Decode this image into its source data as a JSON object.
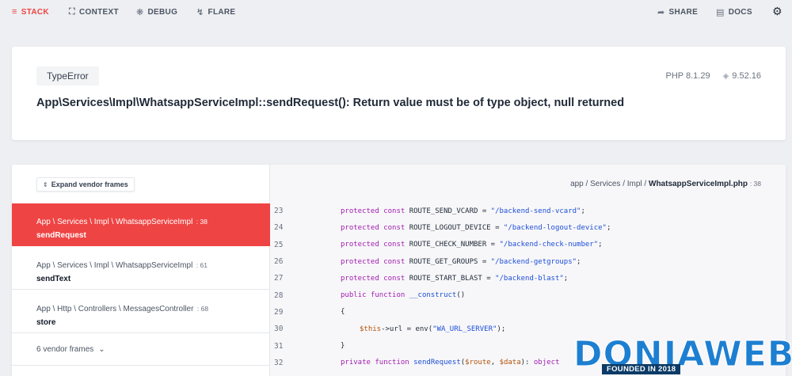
{
  "nav": {
    "stack": "STACK",
    "context": "CONTEXT",
    "debug": "DEBUG",
    "flare": "FLARE",
    "share": "SHARE",
    "docs": "DOCS",
    "icons": [
      "list-icon",
      "context-icon",
      "bug-icon",
      "flare-icon",
      "share-icon",
      "book-icon",
      "gear-icon"
    ]
  },
  "error": {
    "class": "TypeError",
    "php_version": "PHP 8.1.29",
    "laravel_version": "9.52.16",
    "message": "App\\Services\\Impl\\WhatsappServiceImpl::sendRequest(): Return value must be of type object, null returned"
  },
  "stack": {
    "expand_label": "Expand vendor frames",
    "frames": [
      {
        "path": "App \\ Services \\ Impl \\ WhatsappServiceImpl",
        "line": ": 38",
        "method": "sendRequest"
      },
      {
        "path": "App \\ Services \\ Impl \\ WhatsappServiceImpl",
        "line": ": 61",
        "method": "sendText"
      },
      {
        "path": "App \\ Http \\ Controllers \\ MessagesController",
        "line": ": 68",
        "method": "store"
      }
    ],
    "vendor_frames": "6 vendor frames"
  },
  "code": {
    "file_prefix": "app / Services / Impl / ",
    "file_name": "WhatsappServiceImpl.php",
    "file_line": ": 38",
    "lines": [
      {
        "no": "23",
        "text": "protected const ROUTE_SEND_VCARD = \"/backend-send-vcard\";"
      },
      {
        "no": "24",
        "text": "protected const ROUTE_LOGOUT_DEVICE = \"/backend-logout-device\";"
      },
      {
        "no": "25",
        "text": "protected const ROUTE_CHECK_NUMBER = \"/backend-check-number\";"
      },
      {
        "no": "26",
        "text": "protected const ROUTE_GET_GROUPS = \"/backend-getgroups\";"
      },
      {
        "no": "27",
        "text": "protected const ROUTE_START_BLAST = \"/backend-blast\";"
      },
      {
        "no": "28",
        "text": "public function __construct()"
      },
      {
        "no": "29",
        "text": "{"
      },
      {
        "no": "30",
        "text": "$this->url = env(\"WA_URL_SERVER\");"
      },
      {
        "no": "31",
        "text": "}"
      },
      {
        "no": "32",
        "text": "private function sendRequest($route, $data): object"
      }
    ]
  },
  "watermark": {
    "brand": "DONIAWEB",
    "tagline": "FOUNDED IN 2018"
  }
}
